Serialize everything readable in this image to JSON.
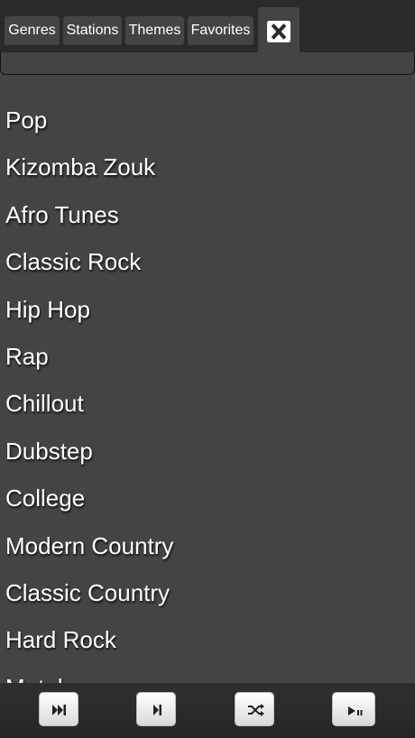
{
  "tabs": [
    {
      "label": "Genres"
    },
    {
      "label": "Stations"
    },
    {
      "label": "Themes"
    },
    {
      "label": "Favorites"
    }
  ],
  "close_icon": "close-x-icon",
  "genres": [
    "Pop",
    "Kizomba Zouk",
    "Afro Tunes",
    "Classic Rock",
    "Hip Hop",
    "Rap",
    "Chillout",
    "Dubstep",
    "College",
    "Modern Country",
    "Classic Country",
    "Hard Rock",
    "Metal"
  ],
  "player": {
    "buttons": [
      {
        "icon": "fast-forward-icon"
      },
      {
        "icon": "skip-next-icon"
      },
      {
        "icon": "shuffle-icon"
      },
      {
        "icon": "play-pause-icon"
      }
    ]
  },
  "colors": {
    "background": "#444444",
    "topbar": "#2a2a2a",
    "text": "#ffffff"
  }
}
